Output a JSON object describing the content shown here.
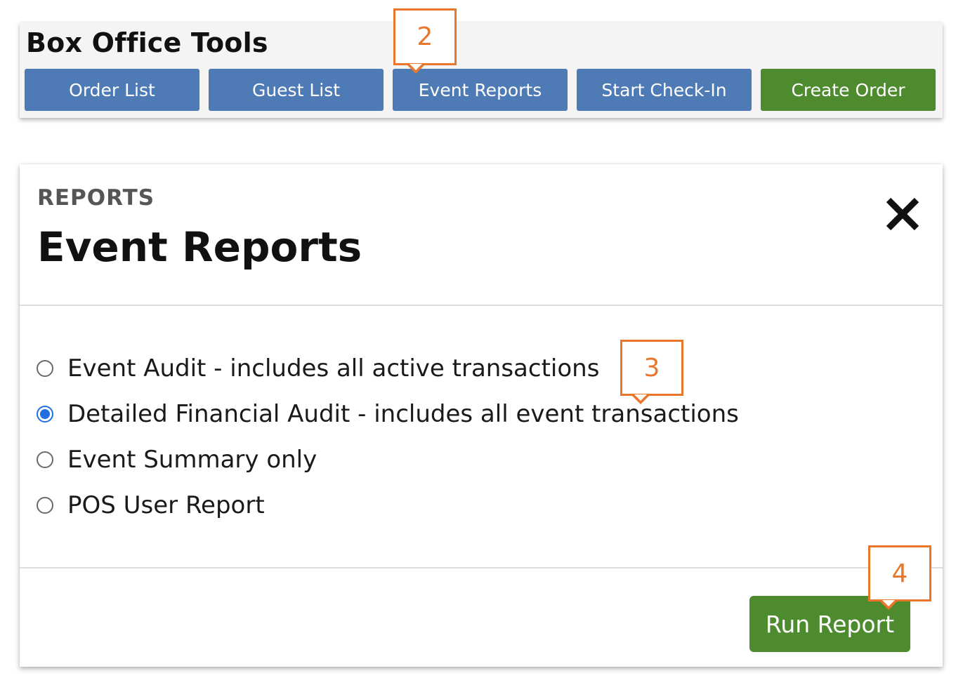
{
  "toolbar": {
    "title": "Box Office Tools",
    "buttons": [
      {
        "label": "Order List",
        "color": "#4e7ab5"
      },
      {
        "label": "Guest List",
        "color": "#4e7ab5"
      },
      {
        "label": "Event Reports",
        "color": "#4e7ab5"
      },
      {
        "label": "Start Check-In",
        "color": "#4e7ab5"
      },
      {
        "label": "Create Order",
        "color": "#4e8a2e"
      }
    ]
  },
  "modal": {
    "eyebrow": "REPORTS",
    "title": "Event Reports",
    "close_icon": "close-icon",
    "options": [
      {
        "label": "Event Audit - includes all active transactions",
        "checked": false
      },
      {
        "label": "Detailed Financial Audit - includes all event transactions",
        "checked": true
      },
      {
        "label": "Event Summary only",
        "checked": false
      },
      {
        "label": "POS User Report",
        "checked": false
      }
    ],
    "run_label": "Run Report"
  },
  "callouts": [
    {
      "label": "2",
      "target": "Event Reports"
    },
    {
      "label": "3",
      "target": "Detailed Financial Audit - includes all event transactions"
    },
    {
      "label": "4",
      "target": "Run Report"
    }
  ],
  "colors": {
    "primary_blue": "#4e7ab5",
    "action_green": "#4e8a2e",
    "callout_orange": "#e8762b",
    "radio_selected": "#1f6fe0"
  }
}
